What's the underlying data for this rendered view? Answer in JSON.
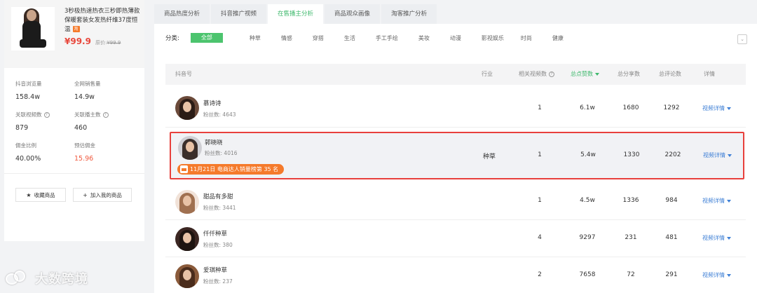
{
  "product": {
    "title": "3秒极热速热衣三秒即热薄款保暖套装女发热纤维37度恒温",
    "tag_icon": "tmall-icon",
    "price": "¥99.9",
    "orig_label": "原价:",
    "orig_price": "¥99.9"
  },
  "stats": {
    "douyin_views_label": "抖音浏览量",
    "douyin_views": "158.4w",
    "total_sales_label": "全网销售量",
    "total_sales": "14.9w",
    "related_videos_label": "关联视频数",
    "related_videos": "879",
    "related_hosts_label": "关联播主数",
    "related_hosts": "460",
    "commission_ratio_label": "佣金比例",
    "commission_ratio": "40.00%",
    "estimated_commission_label": "预估佣金",
    "estimated_commission": "15.96"
  },
  "actions": {
    "favorite": "收藏商品",
    "add_mine": "加入我的商品"
  },
  "tabs": [
    "商品热度分析",
    "抖音推广视频",
    "在售播主分析",
    "商品观众画像",
    "淘客推广分析"
  ],
  "active_tab": 2,
  "filter": {
    "label": "分类:",
    "items": [
      "全部",
      "种草",
      "情感",
      "穿搭",
      "生活",
      "手工手绘",
      "美妆",
      "动漫",
      "影视娱乐",
      "时尚",
      "健康"
    ]
  },
  "columns": {
    "account": "抖音号",
    "industry": "行业",
    "related_videos": "相关视频数",
    "total_likes": "总点赞数",
    "total_shares": "总分享数",
    "total_comments": "总评论数",
    "details": "详情"
  },
  "rows": [
    {
      "name": "慕诗诗",
      "fans_label": "粉丝数:",
      "fans": "4643",
      "industry": "",
      "videos": "1",
      "likes": "6.1w",
      "shares": "1680",
      "comments": "1292",
      "detail": "视频详情"
    },
    {
      "name": "郭晓晓",
      "fans_label": "粉丝数:",
      "fans": "4016",
      "industry": "种草",
      "videos": "1",
      "likes": "5.4w",
      "shares": "1330",
      "comments": "2202",
      "detail": "视频详情",
      "badge": "11月21日 电商达人销量榜第 35 名"
    },
    {
      "name": "甜品有多甜",
      "fans_label": "粉丝数:",
      "fans": "3441",
      "industry": "",
      "videos": "1",
      "likes": "4.5w",
      "shares": "1336",
      "comments": "984",
      "detail": "视频详情"
    },
    {
      "name": "仟仟种草",
      "fans_label": "粉丝数:",
      "fans": "380",
      "industry": "",
      "videos": "4",
      "likes": "9297",
      "shares": "231",
      "comments": "481",
      "detail": "视频详情"
    },
    {
      "name": "爱琪种草",
      "fans_label": "粉丝数:",
      "fans": "237",
      "industry": "",
      "videos": "2",
      "likes": "7658",
      "shares": "72",
      "comments": "291",
      "detail": "视频详情"
    }
  ],
  "watermark": "大数跨境",
  "colors": {
    "accent_green": "#4cc46e",
    "link_blue": "#3f80d6",
    "price_red": "#e8473b",
    "highlight_border": "#e8403c",
    "badge_orange": "#f57a2b"
  }
}
